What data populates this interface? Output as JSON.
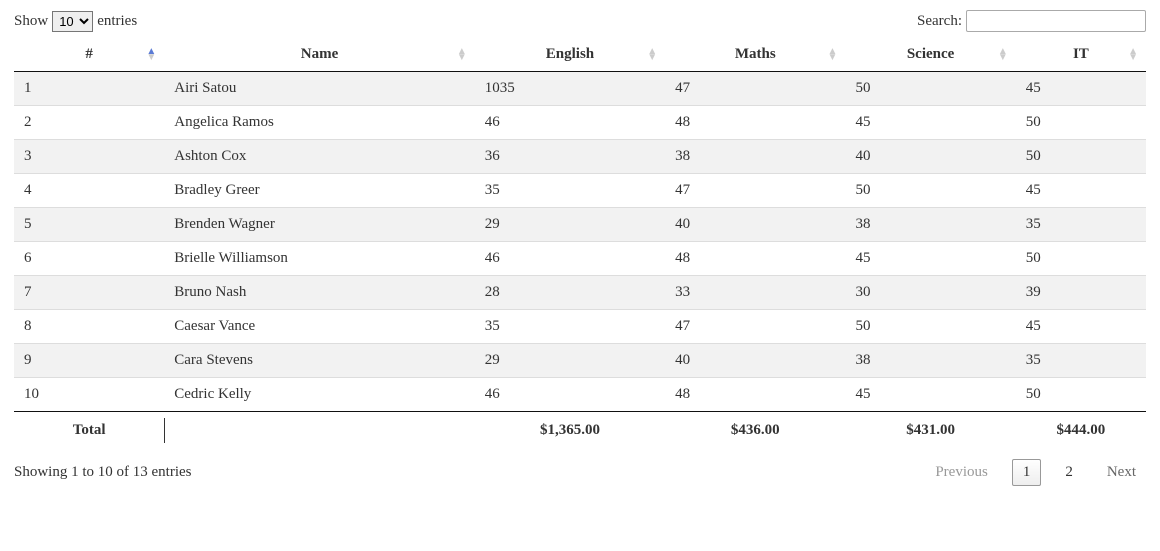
{
  "length": {
    "prefix": "Show",
    "suffix": "entries",
    "selected": "10"
  },
  "search": {
    "label": "Search:",
    "value": ""
  },
  "columns": {
    "index": "#",
    "name": "Name",
    "english": "English",
    "maths": "Maths",
    "science": "Science",
    "it": "IT"
  },
  "rows": [
    {
      "index": "1",
      "name": "Airi Satou",
      "english": "1035",
      "maths": "47",
      "science": "50",
      "it": "45"
    },
    {
      "index": "2",
      "name": "Angelica Ramos",
      "english": "46",
      "maths": "48",
      "science": "45",
      "it": "50"
    },
    {
      "index": "3",
      "name": "Ashton Cox",
      "english": "36",
      "maths": "38",
      "science": "40",
      "it": "50"
    },
    {
      "index": "4",
      "name": "Bradley Greer",
      "english": "35",
      "maths": "47",
      "science": "50",
      "it": "45"
    },
    {
      "index": "5",
      "name": "Brenden Wagner",
      "english": "29",
      "maths": "40",
      "science": "38",
      "it": "35"
    },
    {
      "index": "6",
      "name": "Brielle Williamson",
      "english": "46",
      "maths": "48",
      "science": "45",
      "it": "50"
    },
    {
      "index": "7",
      "name": "Bruno Nash",
      "english": "28",
      "maths": "33",
      "science": "30",
      "it": "39"
    },
    {
      "index": "8",
      "name": "Caesar Vance",
      "english": "35",
      "maths": "47",
      "science": "50",
      "it": "45"
    },
    {
      "index": "9",
      "name": "Cara Stevens",
      "english": "29",
      "maths": "40",
      "science": "38",
      "it": "35"
    },
    {
      "index": "10",
      "name": "Cedric Kelly",
      "english": "46",
      "maths": "48",
      "science": "45",
      "it": "50"
    }
  ],
  "footer": {
    "label": "Total",
    "blank": "",
    "english": "$1,365.00",
    "maths": "$436.00",
    "science": "$431.00",
    "it": "$444.00"
  },
  "info": "Showing 1 to 10 of 13 entries",
  "paginate": {
    "previous": "Previous",
    "page1": "1",
    "page2": "2",
    "next": "Next"
  }
}
